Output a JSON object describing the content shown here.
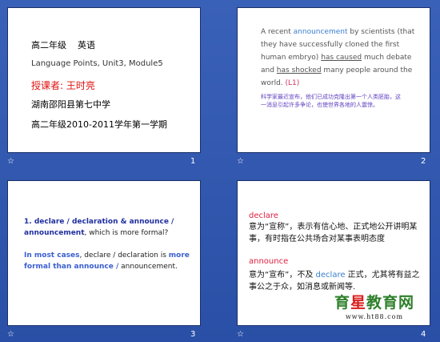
{
  "slides": [
    {
      "number": "1",
      "lines": {
        "grade": "高二年级",
        "subject": "英语",
        "course": "Language Points, Unit3, Module5",
        "teacher": "授课者: 王时亮",
        "school": "湖南邵阳县第七中学",
        "term": "高二年级2010-2011学年第一学期"
      }
    },
    {
      "number": "2",
      "para": {
        "p1": "A recent ",
        "w1": "announcement",
        "p2": " by scientists (that they have successfully cloned the first human embryo) ",
        "w2": "has caused",
        "p3": " much debate and ",
        "w3": "has shocked",
        "p4": " many people around the world. ",
        "ref": "(L1)"
      },
      "translation": "科学家最近宣布，他们已成功克隆出第一个人类胚胎，这一消息引起许多争论，也使世界各地的人震惊。"
    },
    {
      "number": "3",
      "question": {
        "q_bold": "1. declare / declaration & announce / announcement",
        "q_tail": ", which is more formal?"
      },
      "answer": {
        "a1": "In most cases",
        "a2": ", declare / declaration is ",
        "a3": "more formal than announce /",
        "a4": " announcement."
      }
    },
    {
      "number": "4",
      "word1": "declare",
      "def1": "意为“宣称”，表示有信心地、正式地公开讲明某事，有时指在公共场合对某事表明态度",
      "word2": "announce",
      "def2_a": "意为“宣布”，不及 ",
      "def2_en": "declare",
      "def2_b": " 正式，尤其将有益之事公之于众，如消息或新闻等."
    }
  ],
  "slide_marker": "☆",
  "watermark": {
    "t1": "育",
    "t2": "星",
    "t3": "教育网",
    "url": "www.ht88.com"
  }
}
